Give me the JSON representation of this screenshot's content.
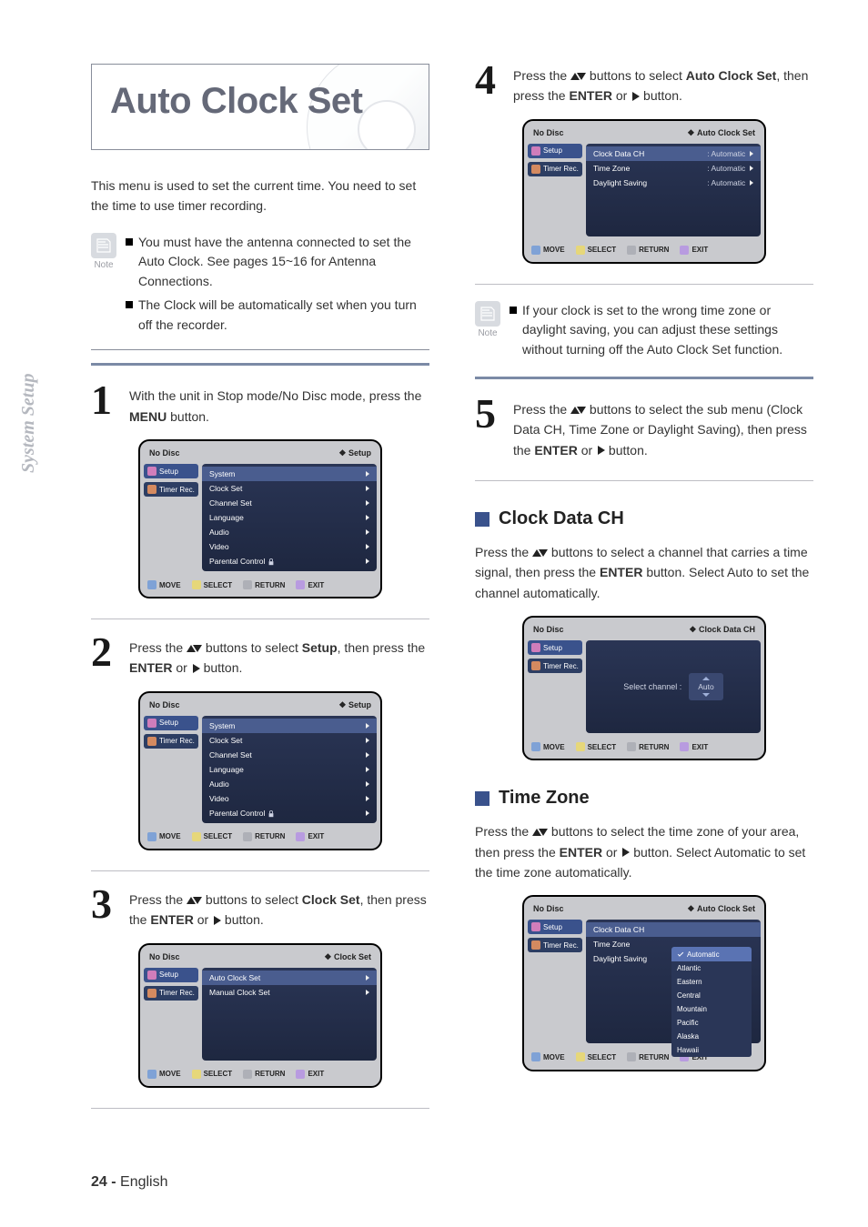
{
  "sidebar": "System Setup",
  "title": "Auto Clock Set",
  "intro": "This menu is used to set the current time. You need to set the time to use timer recording.",
  "note_label": "Note",
  "top_notes": [
    "You must have the antenna connected to set the Auto Clock. See pages 15~16 for Antenna Connections.",
    "The Clock will be automatically set when you turn off the recorder."
  ],
  "steps": {
    "1": {
      "pre": "With the unit in Stop mode/No Disc mode, press the ",
      "b1": "MENU",
      "post": " button."
    },
    "2": {
      "pre": "Press the ",
      "mid": " buttons to select ",
      "b1": "Setup",
      "mid2": ", then press the ",
      "b2": "ENTER",
      "mid3": " or ",
      "post": " button."
    },
    "3": {
      "pre": "Press the ",
      "mid": " buttons to select ",
      "b1": "Clock Set",
      "mid2": ", then press the ",
      "b2": "ENTER",
      "mid3": " or ",
      "post": " button."
    },
    "4": {
      "pre": "Press the ",
      "mid": " buttons to select ",
      "b1": "Auto Clock Set",
      "mid2": ", then press the ",
      "b2": "ENTER",
      "mid3": " or ",
      "post": " button."
    },
    "5": {
      "pre": "Press the ",
      "mid": " buttons to select the sub menu (Clock Data CH, Time Zone or Daylight Saving), then press the ",
      "b2": "ENTER",
      "mid3": " or ",
      "post": " button."
    }
  },
  "right_note": "If your clock is set to the wrong time zone or daylight saving, you can adjust these settings without turning off the Auto Clock Set function.",
  "sections": {
    "clockdata": {
      "title": "Clock Data CH",
      "body_pre": "Press the ",
      "body_mid": " buttons to select a channel that carries a time signal, then press the ",
      "body_b": "ENTER",
      "body_post": " button. Select Auto to set the channel automatically."
    },
    "timezone": {
      "title": "Time Zone",
      "body_pre": "Press the ",
      "body_mid": " buttons to select the time zone of your area, then press the ",
      "body_b": "ENTER",
      "body_mid2": " or ",
      "body_post": " button. Select Automatic to set the time zone automatically."
    }
  },
  "osd": {
    "no_disc": "No Disc",
    "bc_setup": "Setup",
    "bc_clockset": "Clock Set",
    "bc_autoclock": "Auto Clock Set",
    "bc_clockdata": "Clock Data CH",
    "tab_setup": "Setup",
    "tab_timer": "Timer Rec.",
    "menu_setup": [
      "System",
      "Clock Set",
      "Channel Set",
      "Language",
      "Audio",
      "Video",
      "Parental Control"
    ],
    "menu_clockset": [
      "Auto Clock Set",
      "Manual Clock Set"
    ],
    "menu_autoclock": {
      "rows": [
        {
          "label": "Clock Data CH",
          "value": ": Automatic"
        },
        {
          "label": "Time Zone",
          "value": ": Automatic"
        },
        {
          "label": "Daylight Saving",
          "value": ": Automatic"
        }
      ]
    },
    "select_channel_label": "Select channel :",
    "select_channel_value": "Auto",
    "tz_options": [
      "Automatic",
      "Atlantic",
      "Eastern",
      "Central",
      "Mountain",
      "Pacific",
      "Alaska",
      "Hawaii"
    ],
    "foot": {
      "move": "MOVE",
      "select": "SELECT",
      "return": "RETURN",
      "exit": "EXIT"
    },
    "diamond": "❖"
  },
  "footer": {
    "page": "24 -",
    "lang": "English"
  }
}
